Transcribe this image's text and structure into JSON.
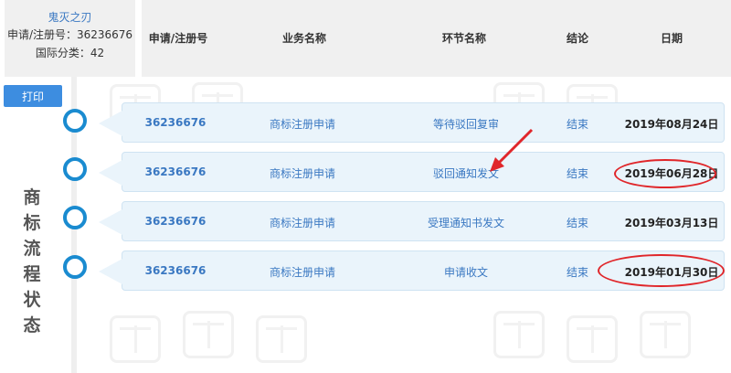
{
  "header": {
    "name": "鬼灭之刃",
    "reg_no_line": "申请/注册号：36236676",
    "class_line": "国际分类：42",
    "columns": [
      "申请/注册号",
      "业务名称",
      "环节名称",
      "结论",
      "日期"
    ]
  },
  "print_label": "打印",
  "side_title": "商标流程状态",
  "rows": [
    {
      "no": "36236676",
      "business": "商标注册申请",
      "step": "等待驳回复审",
      "result": "结束",
      "date": "2019年08月24日"
    },
    {
      "no": "36236676",
      "business": "商标注册申请",
      "step": "驳回通知发文",
      "result": "结束",
      "date": "2019年06月28日"
    },
    {
      "no": "36236676",
      "business": "商标注册申请",
      "step": "受理通知书发文",
      "result": "结束",
      "date": "2019年03月13日"
    },
    {
      "no": "36236676",
      "business": "商标注册申请",
      "step": "申请收文",
      "result": "结束",
      "date": "2019年01月30日"
    }
  ],
  "colors": {
    "accent": "#3a78c2",
    "button": "#3d8de0",
    "timeline_dot": "#1a8bd0",
    "annotation": "#e0262a",
    "row_bg": "#eaf4fb"
  }
}
